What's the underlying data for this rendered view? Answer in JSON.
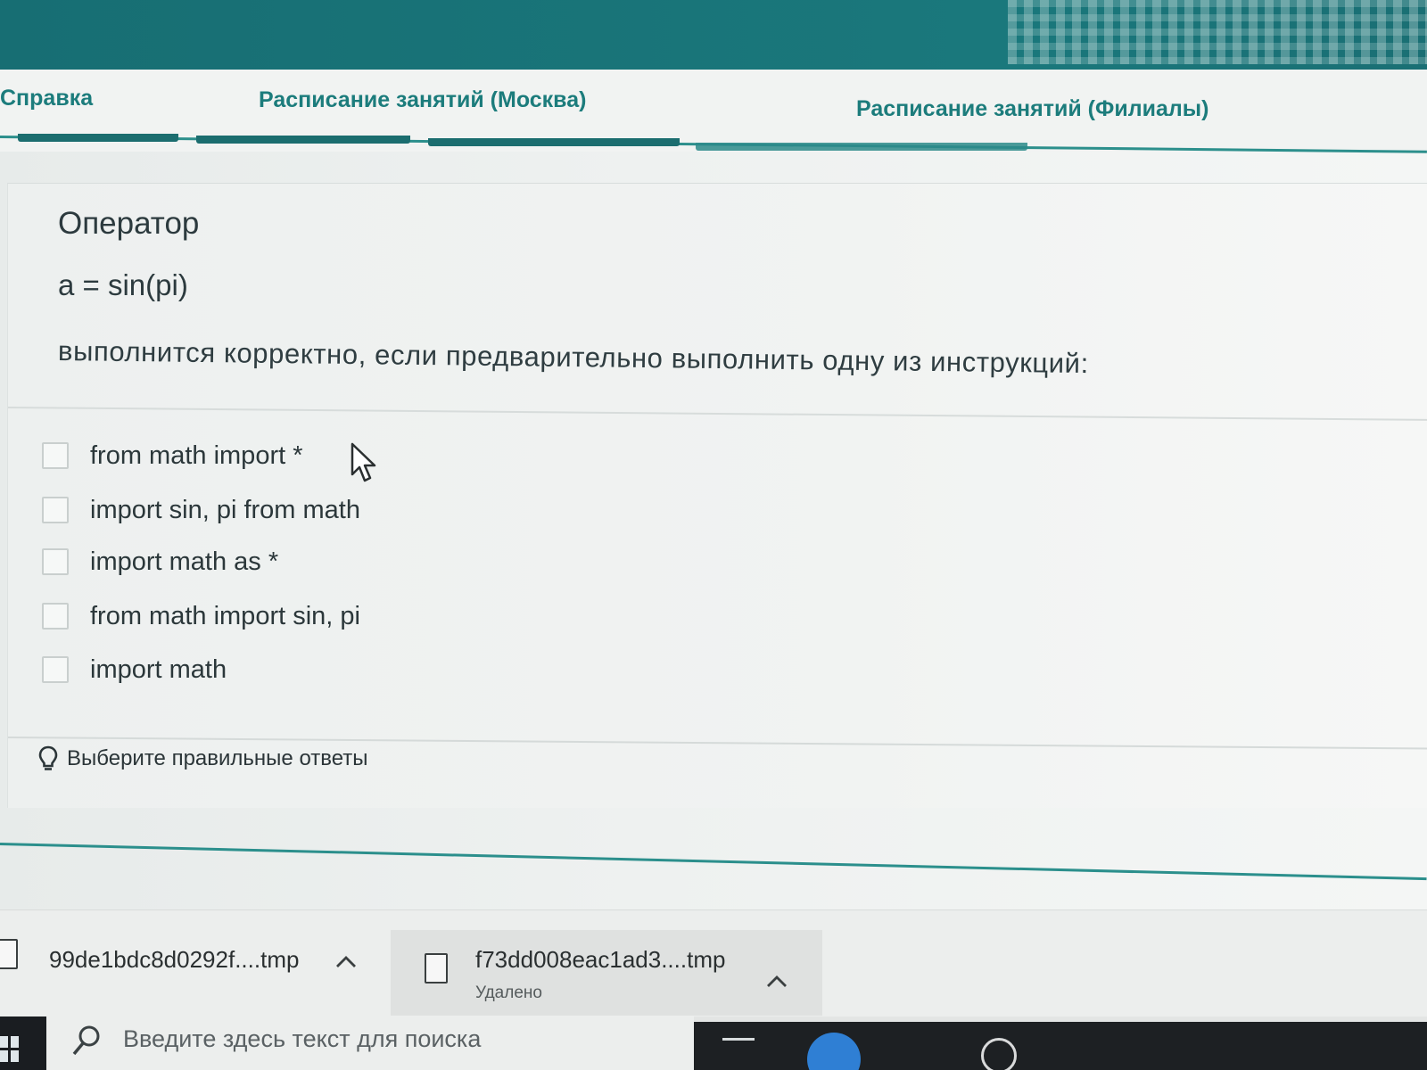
{
  "nav": {
    "items": [
      {
        "label": "Справка"
      },
      {
        "label": "Расписание занятий (Москва)"
      },
      {
        "label": "Расписание занятий (Филиалы)"
      }
    ]
  },
  "question": {
    "title": "Оператор",
    "code": "a = sin(pi)",
    "text": "выполнится корректно, если предварительно выполнить одну из инструкций:",
    "options": [
      {
        "label": "from math import *",
        "checked": false
      },
      {
        "label": "import sin, pi from math",
        "checked": false
      },
      {
        "label": "import math as *",
        "checked": false
      },
      {
        "label": "from math import sin, pi",
        "checked": false
      },
      {
        "label": "import math",
        "checked": false
      }
    ],
    "hint": "Выберите правильные ответы"
  },
  "downloads": {
    "items": [
      {
        "name": "99de1bdc8d0292f....tmp",
        "status": ""
      },
      {
        "name": "f73dd008eac1ad3....tmp",
        "status": "Удалено"
      }
    ]
  },
  "taskbar": {
    "search_placeholder": "Введите здесь текст для поиска"
  },
  "colors": {
    "accent": "#1c7c7c",
    "header": "#176e73",
    "text": "#2c3a3e"
  }
}
